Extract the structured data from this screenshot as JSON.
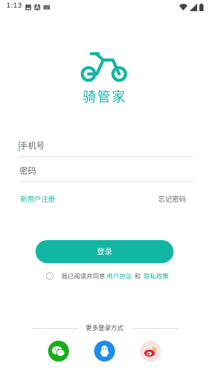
{
  "status_bar": {
    "time": "1:13"
  },
  "brand": {
    "name": "骑管家"
  },
  "form": {
    "phone_placeholder": "手机号",
    "password_placeholder": "密码"
  },
  "links": {
    "register": "新用户注册",
    "forgot": "忘记密码"
  },
  "login_button": "登录",
  "agreement": {
    "prefix": "我已阅读并同意",
    "user_agreement": "用户协议",
    "and": "和",
    "privacy_policy": "隐私政策",
    "checked": false
  },
  "more_login": {
    "title": "更多登录方式",
    "options": [
      "wechat-icon",
      "qq-icon",
      "weibo-icon"
    ]
  },
  "colors": {
    "accent": "#13b6a4",
    "wechat": "#1aad19",
    "qq": "#1c8cf0",
    "weibo_bg": "#fbe3e2"
  }
}
